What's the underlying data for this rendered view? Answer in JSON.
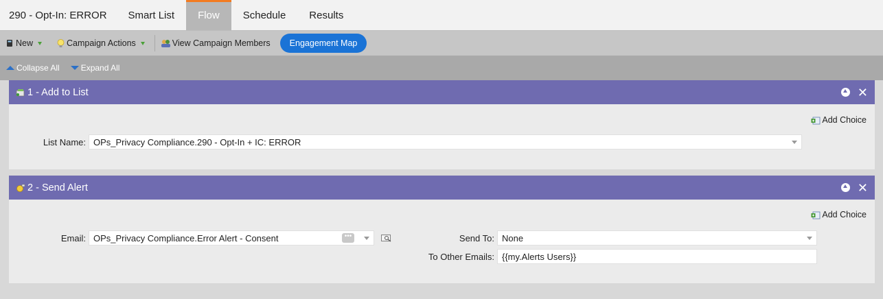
{
  "campaign_title": "290 - Opt-In: ERROR",
  "tabs": [
    {
      "label": "Smart List"
    },
    {
      "label": "Flow"
    },
    {
      "label": "Schedule"
    },
    {
      "label": "Results"
    }
  ],
  "toolbar": {
    "new_label": "New",
    "campaign_actions_label": "Campaign Actions",
    "view_members_label": "View Campaign Members",
    "engagement_map_label": "Engagement Map"
  },
  "subbar": {
    "collapse_label": "Collapse All",
    "expand_label": "Expand All"
  },
  "steps": [
    {
      "title": "1 - Add to List",
      "add_choice_label": "Add Choice",
      "list_name_label": "List Name:",
      "list_name_value": "OPs_Privacy Compliance.290 - Opt-In + IC: ERROR"
    },
    {
      "title": "2 - Send Alert",
      "add_choice_label": "Add Choice",
      "email_label": "Email:",
      "email_value": "OPs_Privacy Compliance.Error Alert - Consent",
      "send_to_label": "Send To:",
      "send_to_value": "None",
      "other_emails_label": "To Other Emails:",
      "other_emails_value": "{{my.Alerts Users}}"
    }
  ],
  "colors": {
    "step_header": "#6f6bb0",
    "active_tab_accent": "#f37b21",
    "pill_blue": "#1a73d6"
  }
}
